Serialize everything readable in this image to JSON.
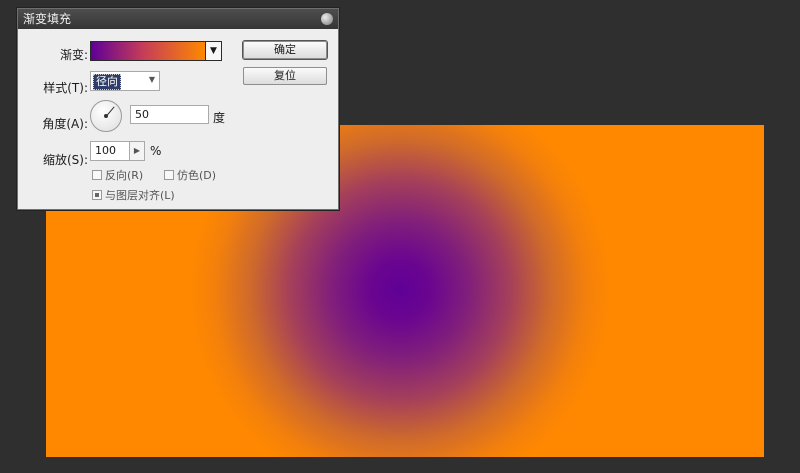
{
  "dialog": {
    "title": "渐变填充",
    "gradient_label": "渐变:",
    "style_label": "样式(T):",
    "style_value": "径向",
    "angle_label": "角度(A):",
    "angle_value": "50",
    "angle_unit": "度",
    "scale_label": "缩放(S):",
    "scale_value": "100",
    "scale_unit": "%",
    "reverse_label": "反向(R)",
    "reverse_checked": false,
    "dither_label": "仿色(D)",
    "dither_checked": false,
    "align_label": "与图层对齐(L)",
    "align_checked": true,
    "ok_label": "确定",
    "reset_label": "复位",
    "gradient_colors": [
      "#5e0097",
      "#ff8800"
    ]
  },
  "canvas": {
    "center_color": "#600097",
    "outer_color": "#ff8800"
  }
}
